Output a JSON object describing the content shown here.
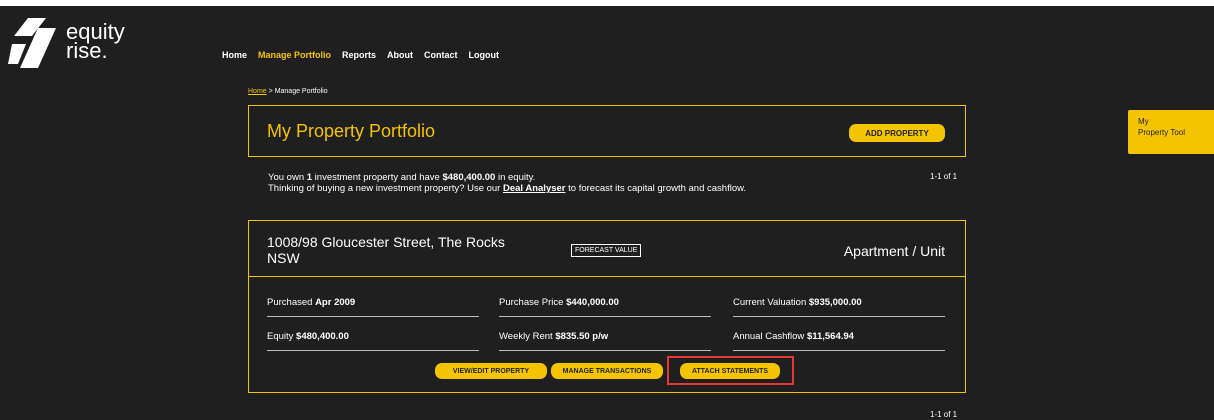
{
  "brand": {
    "line1": "equity",
    "line2": "rise."
  },
  "nav": {
    "home": "Home",
    "manage_portfolio": "Manage Portfolio",
    "reports": "Reports",
    "about": "About",
    "contact": "Contact",
    "logout": "Logout"
  },
  "breadcrumb": {
    "home": "Home",
    "separator": ">",
    "current": "Manage Portfolio"
  },
  "side_tab": {
    "line1": "My",
    "line2": "Property Tool"
  },
  "header": {
    "title": "My Property Portfolio",
    "add_button": "ADD PROPERTY"
  },
  "summary": {
    "line1_pre": "You own ",
    "count": "1",
    "line1_mid": " investment property and have ",
    "equity": "$480,400.00",
    "line1_post": " in equity.",
    "line2_pre": "Thinking of buying a new investment property? Use our ",
    "deal_link": "Deal Analyser",
    "line2_post": " to forecast its capital growth and cashflow."
  },
  "pager": {
    "top": "1-1 of 1",
    "bottom": "1-1 of 1"
  },
  "property": {
    "address": "1008/98 Gloucester Street, The Rocks NSW",
    "forecast_label": "FORECAST VALUE",
    "type": "Apartment / Unit",
    "purchased_label": "Purchased ",
    "purchased_value": "Apr 2009",
    "price_label": "Purchase Price ",
    "price_value": "$440,000.00",
    "valuation_label": "Current Valuation ",
    "valuation_value": "$935,000.00",
    "equity_label": "Equity ",
    "equity_value": "$480,400.00",
    "rent_label": "Weekly Rent ",
    "rent_value": "$835.50 p/w",
    "cashflow_label": "Annual Cashflow ",
    "cashflow_value": "$11,564.94",
    "actions": {
      "view_edit": "VIEW/EDIT PROPERTY",
      "manage_transactions": "MANAGE TRANSACTIONS",
      "attach_statements": "ATTACH STATEMENTS"
    }
  },
  "colors": {
    "accent": "#f5c400",
    "background": "#1f1f1f",
    "highlight": "#e53935"
  },
  "icons": {
    "logo": "equity-rise-logo-icon"
  }
}
